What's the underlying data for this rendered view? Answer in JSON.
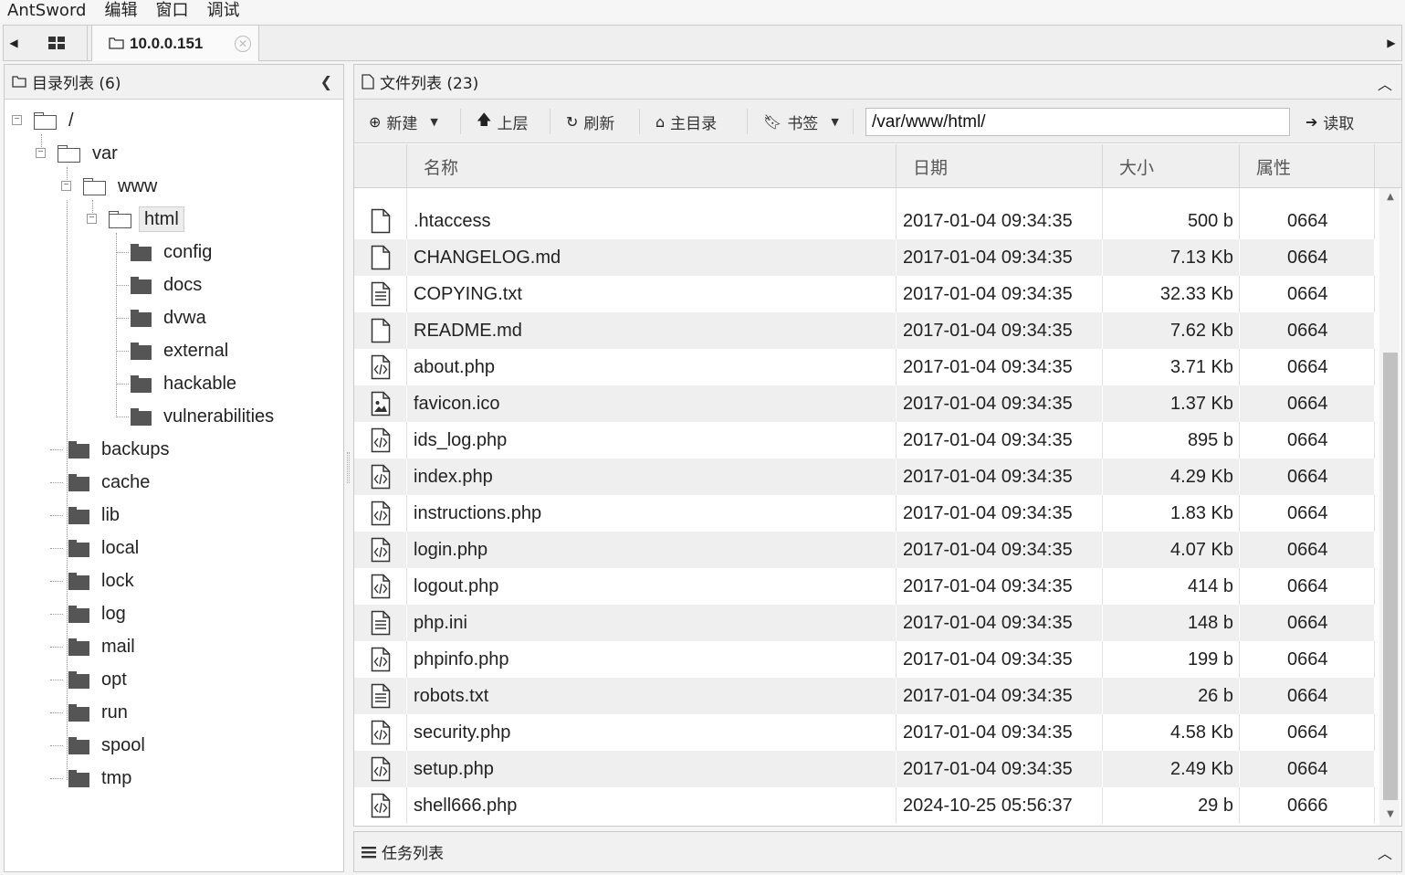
{
  "menubar": {
    "items": [
      "AntSword",
      "编辑",
      "窗口",
      "调试"
    ]
  },
  "tabs": {
    "active_label": "10.0.0.151",
    "home_icon": "grid-icon",
    "close_icon": "close-circle-icon"
  },
  "left_panel": {
    "title": "目录列表 (6)",
    "tree": [
      {
        "label": "/",
        "depth": 0,
        "expanded": true
      },
      {
        "label": "var",
        "depth": 1,
        "expanded": true
      },
      {
        "label": "www",
        "depth": 2,
        "expanded": true
      },
      {
        "label": "html",
        "depth": 3,
        "expanded": true,
        "selected": true
      },
      {
        "label": "config",
        "depth": 4
      },
      {
        "label": "docs",
        "depth": 4
      },
      {
        "label": "dvwa",
        "depth": 4
      },
      {
        "label": "external",
        "depth": 4
      },
      {
        "label": "hackable",
        "depth": 4
      },
      {
        "label": "vulnerabilities",
        "depth": 4
      },
      {
        "label": "backups",
        "depth": 2
      },
      {
        "label": "cache",
        "depth": 2
      },
      {
        "label": "lib",
        "depth": 2
      },
      {
        "label": "local",
        "depth": 2
      },
      {
        "label": "lock",
        "depth": 2
      },
      {
        "label": "log",
        "depth": 2
      },
      {
        "label": "mail",
        "depth": 2
      },
      {
        "label": "opt",
        "depth": 2
      },
      {
        "label": "run",
        "depth": 2
      },
      {
        "label": "spool",
        "depth": 2
      },
      {
        "label": "tmp",
        "depth": 2
      }
    ]
  },
  "right_panel": {
    "title": "文件列表 (23)",
    "toolbar": {
      "new_label": "新建",
      "up_label": "上层",
      "refresh_label": "刷新",
      "home_label": "主目录",
      "bookmark_label": "书签",
      "path_value": "/var/www/html/",
      "read_label": "读取"
    },
    "columns": {
      "name": "名称",
      "date": "日期",
      "size": "大小",
      "attr": "属性"
    },
    "files": [
      {
        "name": ".htaccess",
        "date": "2017-01-04 09:34:35",
        "size": "500 b",
        "attr": "0664",
        "icon": "file-icon"
      },
      {
        "name": "CHANGELOG.md",
        "date": "2017-01-04 09:34:35",
        "size": "7.13 Kb",
        "attr": "0664",
        "icon": "file-icon"
      },
      {
        "name": "COPYING.txt",
        "date": "2017-01-04 09:34:35",
        "size": "32.33 Kb",
        "attr": "0664",
        "icon": "text-file-icon"
      },
      {
        "name": "README.md",
        "date": "2017-01-04 09:34:35",
        "size": "7.62 Kb",
        "attr": "0664",
        "icon": "file-icon"
      },
      {
        "name": "about.php",
        "date": "2017-01-04 09:34:35",
        "size": "3.71 Kb",
        "attr": "0664",
        "icon": "code-file-icon"
      },
      {
        "name": "favicon.ico",
        "date": "2017-01-04 09:34:35",
        "size": "1.37 Kb",
        "attr": "0664",
        "icon": "image-file-icon"
      },
      {
        "name": "ids_log.php",
        "date": "2017-01-04 09:34:35",
        "size": "895 b",
        "attr": "0664",
        "icon": "code-file-icon"
      },
      {
        "name": "index.php",
        "date": "2017-01-04 09:34:35",
        "size": "4.29 Kb",
        "attr": "0664",
        "icon": "code-file-icon"
      },
      {
        "name": "instructions.php",
        "date": "2017-01-04 09:34:35",
        "size": "1.83 Kb",
        "attr": "0664",
        "icon": "code-file-icon"
      },
      {
        "name": "login.php",
        "date": "2017-01-04 09:34:35",
        "size": "4.07 Kb",
        "attr": "0664",
        "icon": "code-file-icon"
      },
      {
        "name": "logout.php",
        "date": "2017-01-04 09:34:35",
        "size": "414 b",
        "attr": "0664",
        "icon": "code-file-icon"
      },
      {
        "name": "php.ini",
        "date": "2017-01-04 09:34:35",
        "size": "148 b",
        "attr": "0664",
        "icon": "text-file-icon"
      },
      {
        "name": "phpinfo.php",
        "date": "2017-01-04 09:34:35",
        "size": "199 b",
        "attr": "0664",
        "icon": "code-file-icon"
      },
      {
        "name": "robots.txt",
        "date": "2017-01-04 09:34:35",
        "size": "26 b",
        "attr": "0664",
        "icon": "text-file-icon"
      },
      {
        "name": "security.php",
        "date": "2017-01-04 09:34:35",
        "size": "4.58 Kb",
        "attr": "0664",
        "icon": "code-file-icon"
      },
      {
        "name": "setup.php",
        "date": "2017-01-04 09:34:35",
        "size": "2.49 Kb",
        "attr": "0664",
        "icon": "code-file-icon"
      },
      {
        "name": "shell666.php",
        "date": "2024-10-25 05:56:37",
        "size": "29 b",
        "attr": "0666",
        "icon": "code-file-icon"
      }
    ]
  },
  "task_panel": {
    "title": "任务列表"
  }
}
